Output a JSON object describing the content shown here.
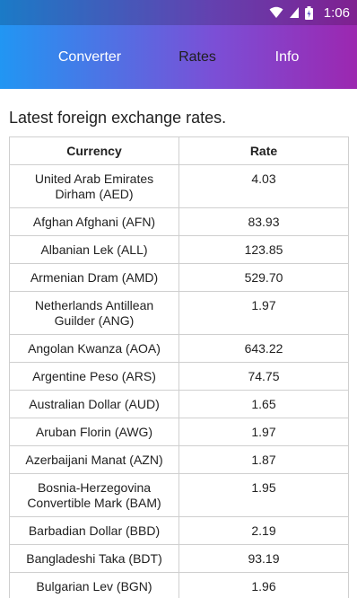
{
  "status": {
    "time": "1:06",
    "icons": [
      "wifi-icon",
      "signal-icon",
      "battery-icon"
    ]
  },
  "tabs": [
    {
      "label": "Converter",
      "selected": false
    },
    {
      "label": "Rates",
      "selected": true
    },
    {
      "label": "Info",
      "selected": false
    }
  ],
  "colors": {
    "appbar_start": "#2196F3",
    "appbar_end": "#9C27B0",
    "selected_tab_text": "#1f1f1f",
    "tab_text": "#ffffff"
  },
  "heading": "Latest foreign exchange rates.",
  "table": {
    "headers": {
      "currency": "Currency",
      "rate": "Rate"
    },
    "rows": [
      {
        "currency": "United Arab Emirates Dirham (AED)",
        "rate": "4.03"
      },
      {
        "currency": "Afghan Afghani (AFN)",
        "rate": "83.93"
      },
      {
        "currency": "Albanian Lek (ALL)",
        "rate": "123.85"
      },
      {
        "currency": "Armenian Dram (AMD)",
        "rate": "529.70"
      },
      {
        "currency": "Netherlands Antillean Guilder (ANG)",
        "rate": "1.97"
      },
      {
        "currency": "Angolan Kwanza (AOA)",
        "rate": "643.22"
      },
      {
        "currency": "Argentine Peso (ARS)",
        "rate": "74.75"
      },
      {
        "currency": "Australian Dollar (AUD)",
        "rate": "1.65"
      },
      {
        "currency": "Aruban Florin (AWG)",
        "rate": "1.97"
      },
      {
        "currency": "Azerbaijani Manat (AZN)",
        "rate": "1.87"
      },
      {
        "currency": "Bosnia-Herzegovina Convertible Mark (BAM)",
        "rate": "1.95"
      },
      {
        "currency": "Barbadian Dollar (BBD)",
        "rate": "2.19"
      },
      {
        "currency": "Bangladeshi Taka (BDT)",
        "rate": "93.19"
      },
      {
        "currency": "Bulgarian Lev (BGN)",
        "rate": "1.96"
      }
    ]
  }
}
